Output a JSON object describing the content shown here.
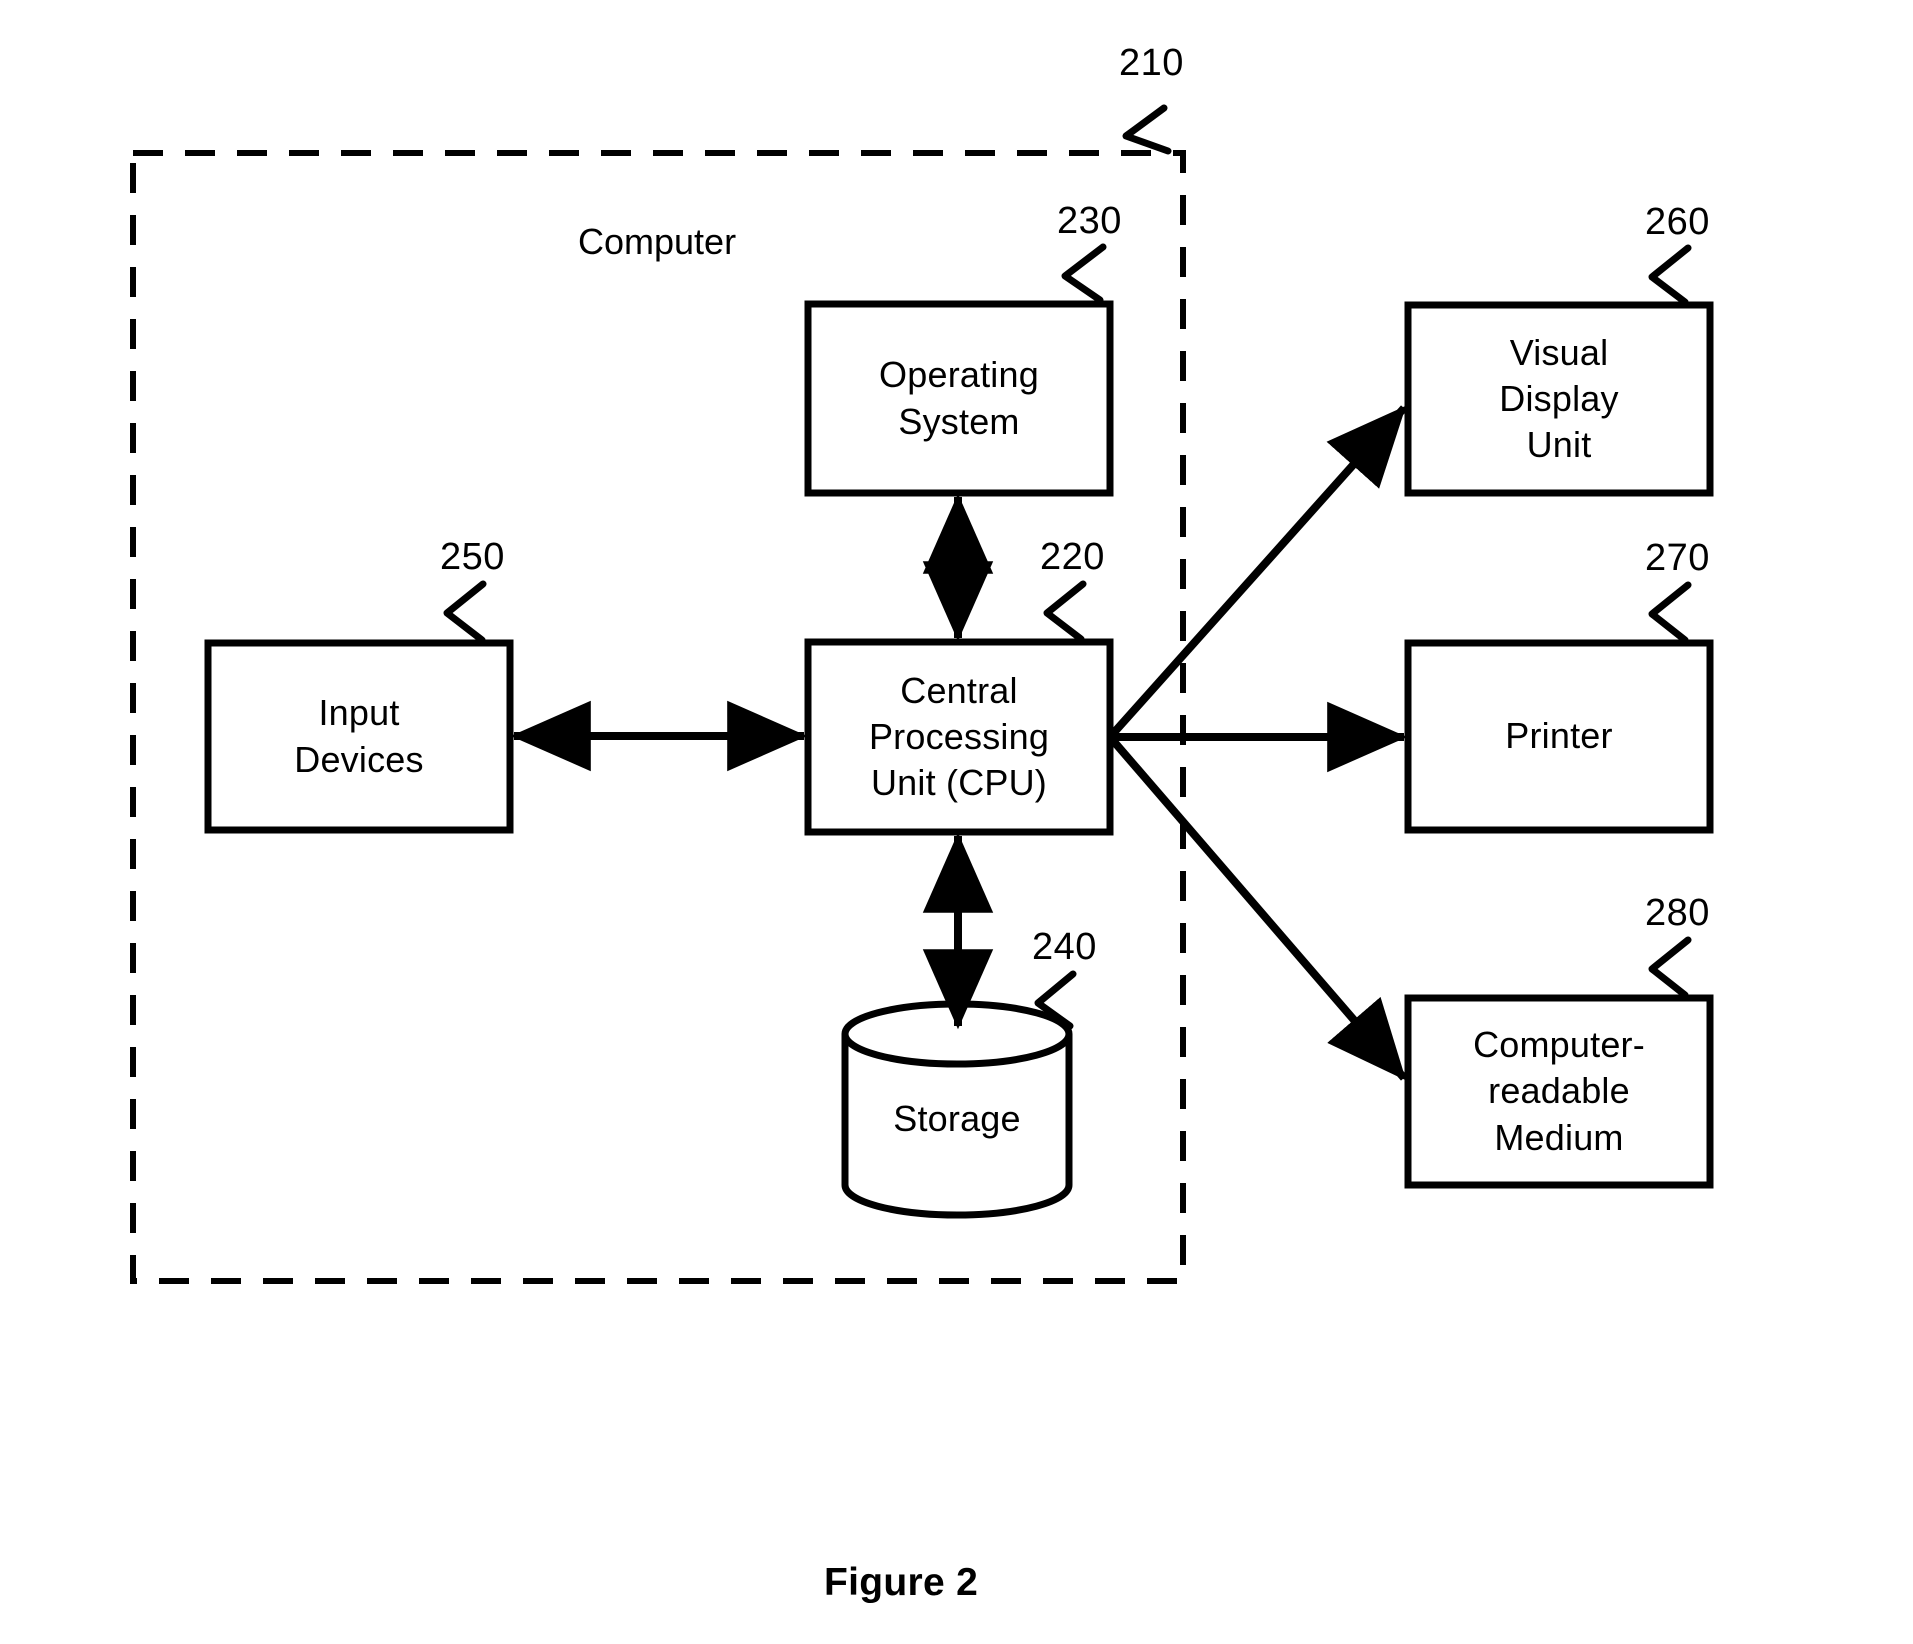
{
  "figure": {
    "caption": "Figure 2",
    "container_label": "Computer",
    "container_ref": "210"
  },
  "boxes": {
    "operating_system": {
      "label": "Operating\nSystem",
      "ref": "230"
    },
    "cpu": {
      "label": "Central\nProcessing\nUnit (CPU)",
      "ref": "220"
    },
    "input_devices": {
      "label": "Input\nDevices",
      "ref": "250"
    },
    "storage": {
      "label": "Storage",
      "ref": "240"
    },
    "visual_display_unit": {
      "label": "Visual\nDisplay\nUnit",
      "ref": "260"
    },
    "printer": {
      "label": "Printer",
      "ref": "270"
    },
    "computer_readable_medium": {
      "label": "Computer-\nreadable\nMedium",
      "ref": "280"
    }
  },
  "connections": [
    {
      "name": "os-cpu",
      "from": "operating_system",
      "to": "cpu",
      "style": "double-arrow"
    },
    {
      "name": "input-cpu",
      "from": "input_devices",
      "to": "cpu",
      "style": "double-arrow"
    },
    {
      "name": "cpu-storage",
      "from": "cpu",
      "to": "storage",
      "style": "double-arrow"
    },
    {
      "name": "cpu-visual-display-unit",
      "from": "cpu",
      "to": "visual_display_unit",
      "style": "single-arrow"
    },
    {
      "name": "cpu-printer",
      "from": "cpu",
      "to": "printer",
      "style": "single-arrow"
    },
    {
      "name": "cpu-computer-readable-medium",
      "from": "cpu",
      "to": "computer_readable_medium",
      "style": "single-arrow"
    }
  ],
  "colors": {
    "stroke": "#000000",
    "background": "#ffffff"
  }
}
